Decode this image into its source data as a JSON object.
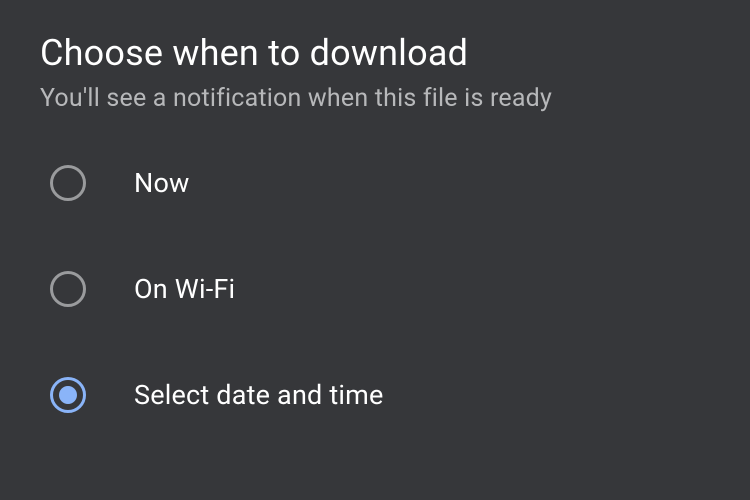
{
  "dialog": {
    "title": "Choose when to download",
    "subtitle": "You'll see a notification when this file is ready",
    "options": [
      {
        "label": "Now",
        "selected": false
      },
      {
        "label": "On Wi-Fi",
        "selected": false
      },
      {
        "label": "Select date and time",
        "selected": true
      }
    ]
  }
}
